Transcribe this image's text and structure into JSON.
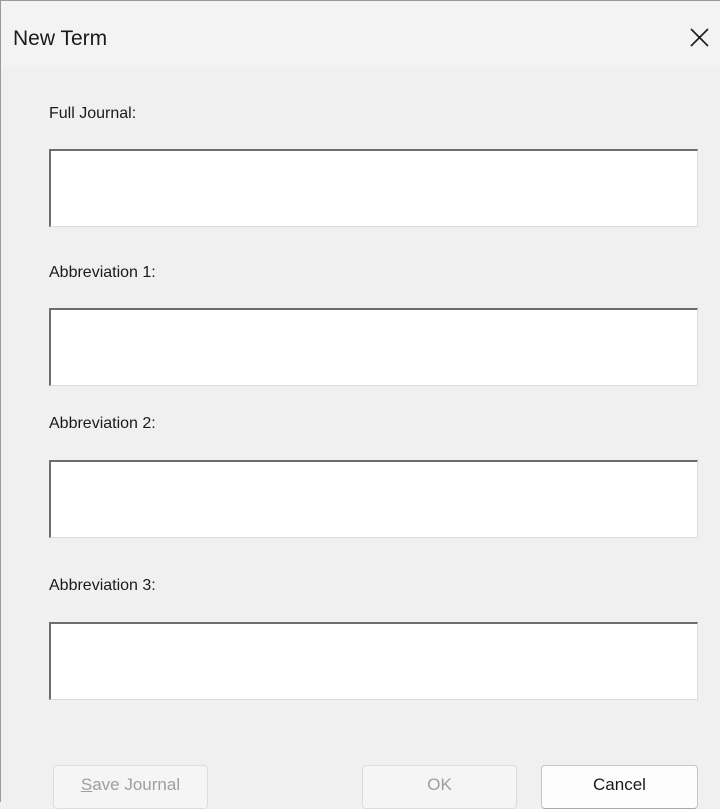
{
  "dialog": {
    "title": "New Term",
    "close_icon": "close-icon"
  },
  "fields": {
    "full_journal": {
      "label": "Full Journal:",
      "value": ""
    },
    "abbreviation_1": {
      "label": "Abbreviation 1:",
      "value": ""
    },
    "abbreviation_2": {
      "label": "Abbreviation 2:",
      "value": ""
    },
    "abbreviation_3": {
      "label": "Abbreviation 3:",
      "value": ""
    }
  },
  "buttons": {
    "save_journal_mnemonic": "S",
    "save_journal_rest": "ave Journal",
    "ok": "OK",
    "cancel": "Cancel"
  },
  "colors": {
    "background": "#f0f0f0",
    "disabled_text": "#9e9e9e"
  }
}
